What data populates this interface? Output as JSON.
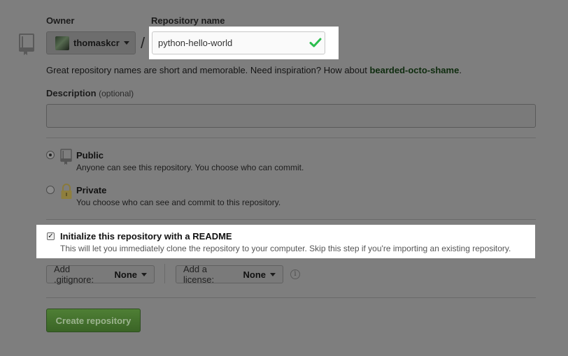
{
  "owner": {
    "label": "Owner",
    "value": "thomaskcr"
  },
  "repo_name": {
    "label": "Repository name",
    "value": "python-hello-world",
    "separator": "/"
  },
  "hint": {
    "text": "Great repository names are short and memorable. Need inspiration? How about ",
    "suggestion": "bearded-octo-shame",
    "suffix": "."
  },
  "description": {
    "label": "Description",
    "optional": "(optional)",
    "value": ""
  },
  "visibility": {
    "public": {
      "title": "Public",
      "desc": "Anyone can see this repository. You choose who can commit.",
      "selected": true
    },
    "private": {
      "title": "Private",
      "desc": "You choose who can see and commit to this repository.",
      "selected": false
    }
  },
  "readme": {
    "title": "Initialize this repository with a README",
    "desc": "This will let you immediately clone the repository to your computer. Skip this step if you're importing an existing repository.",
    "checked": true
  },
  "gitignore": {
    "label": "Add .gitignore:",
    "value": "None"
  },
  "license": {
    "label": "Add a license:",
    "value": "None"
  },
  "create_button": "Create repository",
  "colors": {
    "overlay": "#7e7e7e",
    "check_green": "#2cbe4e",
    "button_green": "#4f7f35"
  }
}
